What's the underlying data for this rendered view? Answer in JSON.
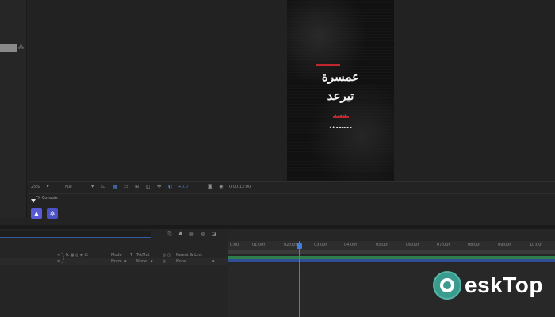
{
  "viewer": {
    "artwork_line1": "عمسرة",
    "artwork_line2": "تيرعد",
    "artwork_small1": "عمسرة",
    "artwork_small2": "• ♦ ▪ ▪▪▪ ▪ ▪"
  },
  "viewer_toolbar": {
    "zoom": "25%",
    "resolution": "Full",
    "exposure": "+0.0",
    "timecode": "0:00:12:00"
  },
  "extension_panel": {
    "tab_label": "FX Console",
    "button1_icon": "image-icon",
    "button2_icon": "gear-icon"
  },
  "timeline": {
    "columns": {
      "mode": "Mode",
      "t": "T",
      "trkmat": "TrkMat",
      "parent": "Parent & Link"
    },
    "row": {
      "mode_value": "Norm",
      "trkmat_value": "None",
      "parent_value": "None"
    },
    "ruler_ticks": [
      "0:00",
      "01:00f",
      "02:00f",
      "03:00f",
      "04:00f",
      "05:00f",
      "06:00f",
      "07:00f",
      "08:00f",
      "09:00f",
      "10:00f"
    ]
  },
  "watermark": {
    "text": "eskTop"
  },
  "colors": {
    "accent_blue": "#3d7fd9",
    "track_green": "#2e7d4a",
    "extension_purple": "#5a5ad6",
    "watermark_teal": "#3a9b8f"
  }
}
